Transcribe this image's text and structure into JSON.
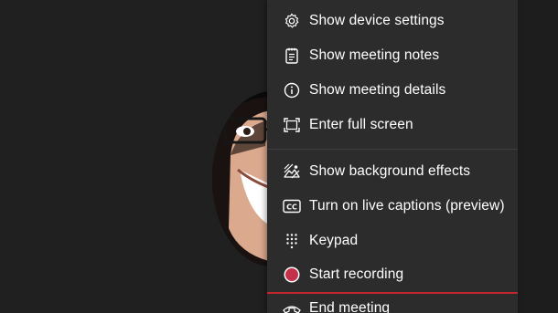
{
  "menu": {
    "items": [
      {
        "label": "Show device settings",
        "icon": "gear-icon"
      },
      {
        "label": "Show meeting notes",
        "icon": "notes-icon"
      },
      {
        "label": "Show meeting details",
        "icon": "info-icon"
      },
      {
        "label": "Enter full screen",
        "icon": "fullscreen-icon"
      },
      {
        "label": "Show background effects",
        "icon": "background-effects-icon"
      },
      {
        "label": "Turn on live captions (preview)",
        "icon": "captions-icon"
      },
      {
        "label": "Keypad",
        "icon": "keypad-icon"
      },
      {
        "label": "Start recording",
        "icon": "record-icon"
      },
      {
        "label": "End meeting",
        "icon": "end-meeting-icon"
      }
    ]
  },
  "colors": {
    "menu_background": "#2d2c2c",
    "record_red": "#c4314b",
    "highlight_border": "#c4262e"
  }
}
